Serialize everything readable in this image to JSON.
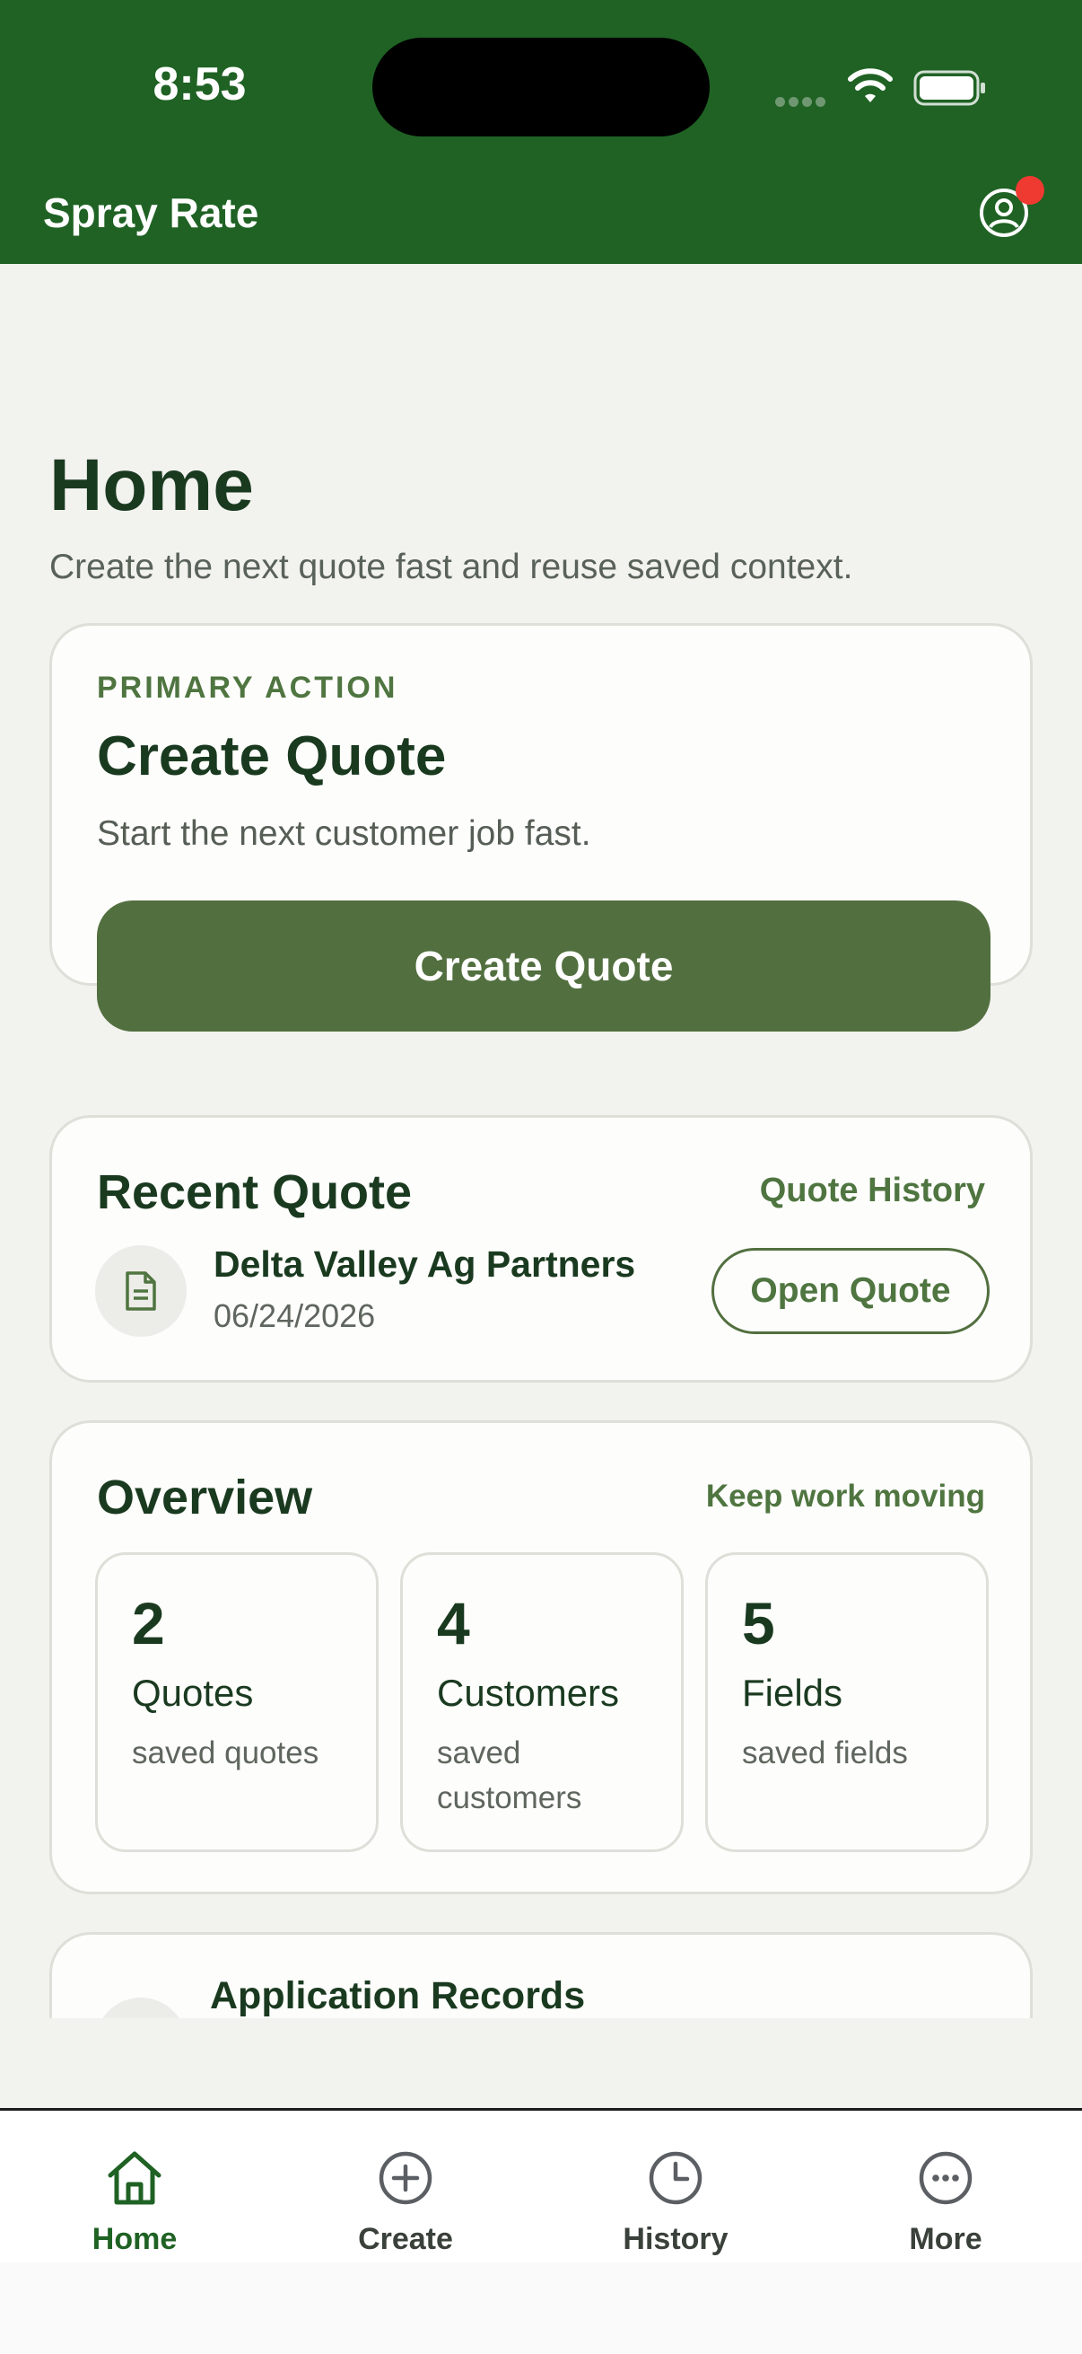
{
  "status_bar": {
    "time": "8:53"
  },
  "app_bar": {
    "title": "Spray Rate"
  },
  "page": {
    "title": "Home",
    "subtitle": "Create the next quote fast and reuse saved context."
  },
  "primary_card": {
    "eyebrow": "PRIMARY ACTION",
    "title": "Create Quote",
    "description": "Start the next customer job fast.",
    "button_label": "Create Quote"
  },
  "recent_quote": {
    "title": "Recent Quote",
    "link": "Quote History",
    "customer": "Delta Valley Ag Partners",
    "date": "06/24/2026",
    "button_label": "Open Quote"
  },
  "overview": {
    "title": "Overview",
    "link": "Keep work moving",
    "stats": [
      {
        "value": "2",
        "label": "Quotes",
        "desc": "saved quotes"
      },
      {
        "value": "4",
        "label": "Customers",
        "desc": "saved customers"
      },
      {
        "value": "5",
        "label": "Fields",
        "desc": "saved fields"
      }
    ]
  },
  "next_section": {
    "title": "Application Records"
  },
  "tabs": [
    {
      "label": "Home",
      "icon": "home-icon",
      "active": true
    },
    {
      "label": "Create",
      "icon": "plus-circle-icon",
      "active": false
    },
    {
      "label": "History",
      "icon": "clock-icon",
      "active": false
    },
    {
      "label": "More",
      "icon": "more-icon",
      "active": false
    }
  ],
  "colors": {
    "brand_green": "#1f6224",
    "button_green": "#526f3f",
    "notification_red": "#ef3a32",
    "background": "#f2f2ef"
  }
}
